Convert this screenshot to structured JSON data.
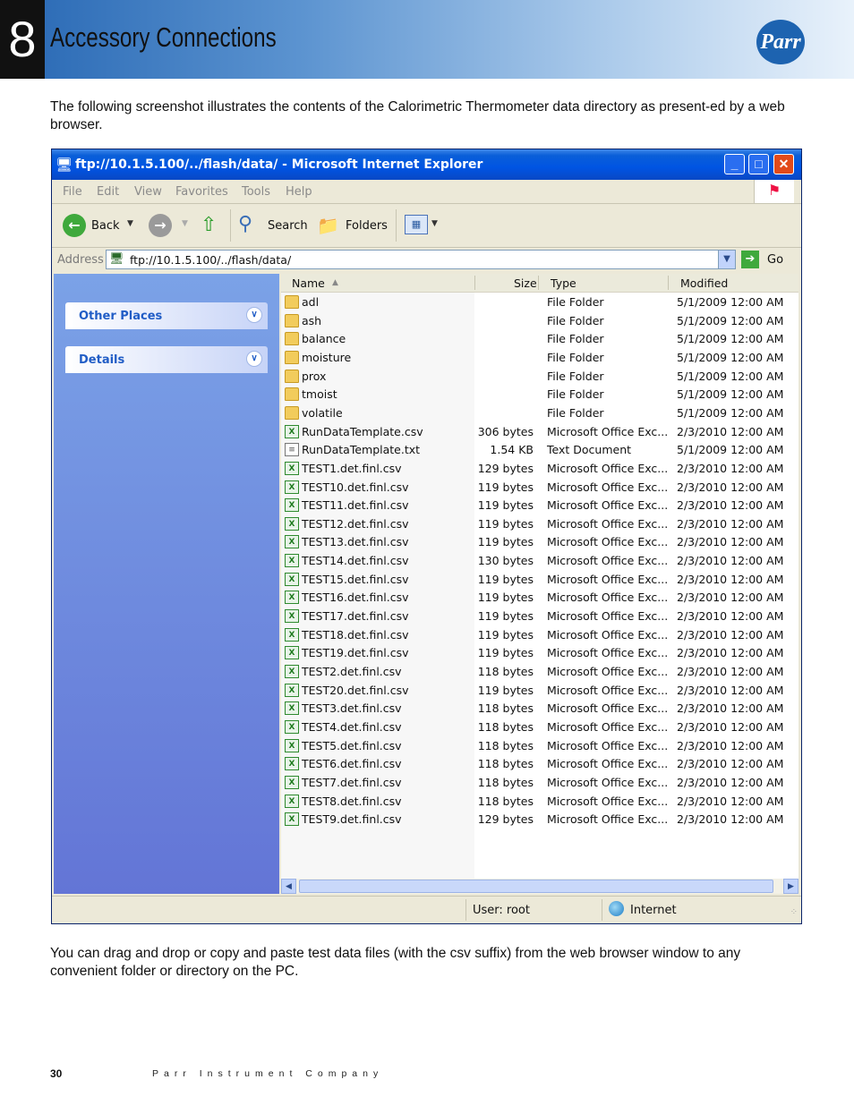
{
  "header": {
    "chapter_number": "8",
    "chapter_title": "Accessory Connections",
    "logo_text": "Parr"
  },
  "intro_text": "The following screenshot illustrates the contents of the Calorimetric Thermometer data directory as present-ed by a web browser.",
  "browser": {
    "title": "ftp://10.1.5.100/../flash/data/ - Microsoft Internet Explorer",
    "menu": [
      "File",
      "Edit",
      "View",
      "Favorites",
      "Tools",
      "Help"
    ],
    "toolbar": {
      "back_label": "Back",
      "search_label": "Search",
      "folders_label": "Folders"
    },
    "address": {
      "label": "Address",
      "value": "ftp://10.1.5.100/../flash/data/",
      "go_label": "Go"
    },
    "tasks": [
      "Other Places",
      "Details"
    ],
    "columns": {
      "name": "Name",
      "size": "Size",
      "type": "Type",
      "modified": "Modified"
    },
    "files": [
      {
        "icon": "folder",
        "name": "adl",
        "size": "",
        "type": "File Folder",
        "modified": "5/1/2009 12:00 AM"
      },
      {
        "icon": "folder",
        "name": "ash",
        "size": "",
        "type": "File Folder",
        "modified": "5/1/2009 12:00 AM"
      },
      {
        "icon": "folder",
        "name": "balance",
        "size": "",
        "type": "File Folder",
        "modified": "5/1/2009 12:00 AM"
      },
      {
        "icon": "folder",
        "name": "moisture",
        "size": "",
        "type": "File Folder",
        "modified": "5/1/2009 12:00 AM"
      },
      {
        "icon": "folder",
        "name": "prox",
        "size": "",
        "type": "File Folder",
        "modified": "5/1/2009 12:00 AM"
      },
      {
        "icon": "folder",
        "name": "tmoist",
        "size": "",
        "type": "File Folder",
        "modified": "5/1/2009 12:00 AM"
      },
      {
        "icon": "folder",
        "name": "volatile",
        "size": "",
        "type": "File Folder",
        "modified": "5/1/2009 12:00 AM"
      },
      {
        "icon": "csv",
        "name": "RunDataTemplate.csv",
        "size": "306 bytes",
        "type": "Microsoft Office Exc...",
        "modified": "2/3/2010 12:00 AM"
      },
      {
        "icon": "txt",
        "name": "RunDataTemplate.txt",
        "size": "1.54 KB",
        "type": "Text Document",
        "modified": "5/1/2009 12:00 AM"
      },
      {
        "icon": "csv",
        "name": "TEST1.det.finl.csv",
        "size": "129 bytes",
        "type": "Microsoft Office Exc...",
        "modified": "2/3/2010 12:00 AM"
      },
      {
        "icon": "csv",
        "name": "TEST10.det.finl.csv",
        "size": "119 bytes",
        "type": "Microsoft Office Exc...",
        "modified": "2/3/2010 12:00 AM"
      },
      {
        "icon": "csv",
        "name": "TEST11.det.finl.csv",
        "size": "119 bytes",
        "type": "Microsoft Office Exc...",
        "modified": "2/3/2010 12:00 AM"
      },
      {
        "icon": "csv",
        "name": "TEST12.det.finl.csv",
        "size": "119 bytes",
        "type": "Microsoft Office Exc...",
        "modified": "2/3/2010 12:00 AM"
      },
      {
        "icon": "csv",
        "name": "TEST13.det.finl.csv",
        "size": "119 bytes",
        "type": "Microsoft Office Exc...",
        "modified": "2/3/2010 12:00 AM"
      },
      {
        "icon": "csv",
        "name": "TEST14.det.finl.csv",
        "size": "130 bytes",
        "type": "Microsoft Office Exc...",
        "modified": "2/3/2010 12:00 AM"
      },
      {
        "icon": "csv",
        "name": "TEST15.det.finl.csv",
        "size": "119 bytes",
        "type": "Microsoft Office Exc...",
        "modified": "2/3/2010 12:00 AM"
      },
      {
        "icon": "csv",
        "name": "TEST16.det.finl.csv",
        "size": "119 bytes",
        "type": "Microsoft Office Exc...",
        "modified": "2/3/2010 12:00 AM"
      },
      {
        "icon": "csv",
        "name": "TEST17.det.finl.csv",
        "size": "119 bytes",
        "type": "Microsoft Office Exc...",
        "modified": "2/3/2010 12:00 AM"
      },
      {
        "icon": "csv",
        "name": "TEST18.det.finl.csv",
        "size": "119 bytes",
        "type": "Microsoft Office Exc...",
        "modified": "2/3/2010 12:00 AM"
      },
      {
        "icon": "csv",
        "name": "TEST19.det.finl.csv",
        "size": "119 bytes",
        "type": "Microsoft Office Exc...",
        "modified": "2/3/2010 12:00 AM"
      },
      {
        "icon": "csv",
        "name": "TEST2.det.finl.csv",
        "size": "118 bytes",
        "type": "Microsoft Office Exc...",
        "modified": "2/3/2010 12:00 AM"
      },
      {
        "icon": "csv",
        "name": "TEST20.det.finl.csv",
        "size": "119 bytes",
        "type": "Microsoft Office Exc...",
        "modified": "2/3/2010 12:00 AM"
      },
      {
        "icon": "csv",
        "name": "TEST3.det.finl.csv",
        "size": "118 bytes",
        "type": "Microsoft Office Exc...",
        "modified": "2/3/2010 12:00 AM"
      },
      {
        "icon": "csv",
        "name": "TEST4.det.finl.csv",
        "size": "118 bytes",
        "type": "Microsoft Office Exc...",
        "modified": "2/3/2010 12:00 AM"
      },
      {
        "icon": "csv",
        "name": "TEST5.det.finl.csv",
        "size": "118 bytes",
        "type": "Microsoft Office Exc...",
        "modified": "2/3/2010 12:00 AM"
      },
      {
        "icon": "csv",
        "name": "TEST6.det.finl.csv",
        "size": "118 bytes",
        "type": "Microsoft Office Exc...",
        "modified": "2/3/2010 12:00 AM"
      },
      {
        "icon": "csv",
        "name": "TEST7.det.finl.csv",
        "size": "118 bytes",
        "type": "Microsoft Office Exc...",
        "modified": "2/3/2010 12:00 AM"
      },
      {
        "icon": "csv",
        "name": "TEST8.det.finl.csv",
        "size": "118 bytes",
        "type": "Microsoft Office Exc...",
        "modified": "2/3/2010 12:00 AM"
      },
      {
        "icon": "csv",
        "name": "TEST9.det.finl.csv",
        "size": "129 bytes",
        "type": "Microsoft Office Exc...",
        "modified": "2/3/2010 12:00 AM"
      }
    ],
    "status": {
      "user": "User: root",
      "zone": "Internet"
    }
  },
  "outro_text": "You can drag and drop or copy and paste test data files (with the csv suffix) from the web browser window to any convenient folder or directory on the PC.",
  "footer": {
    "page_number": "30",
    "company": "Parr Instrument Company"
  },
  "colors": {
    "header_blue": "#2767b3",
    "xp_title_blue": "#0054e3",
    "task_pane_blue": "#6375d6"
  }
}
